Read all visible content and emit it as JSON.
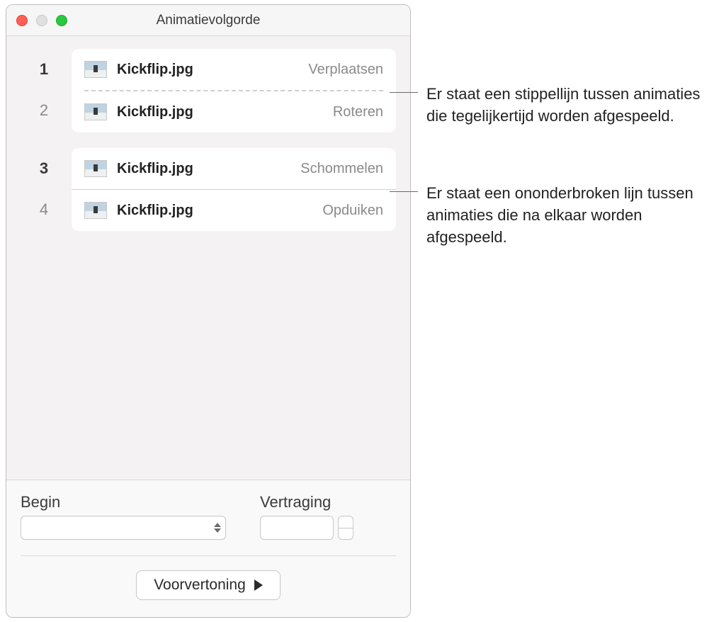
{
  "window": {
    "title": "Animatievolgorde"
  },
  "rows": [
    {
      "num": "1",
      "numClass": "",
      "file": "Kickflip.jpg",
      "effect": "Verplaatsen"
    },
    {
      "num": "2",
      "numClass": "secondary",
      "file": "Kickflip.jpg",
      "effect": "Roteren"
    },
    {
      "num": "3",
      "numClass": "",
      "file": "Kickflip.jpg",
      "effect": "Schommelen"
    },
    {
      "num": "4",
      "numClass": "secondary",
      "file": "Kickflip.jpg",
      "effect": "Opduiken"
    }
  ],
  "footer": {
    "begin_label": "Begin",
    "delay_label": "Vertraging",
    "preview_label": "Voorvertoning"
  },
  "callouts": {
    "dashed": "Er staat een stippellijn tussen animaties die tegelijkertijd worden afgespeeld.",
    "solid": "Er staat een ononderbroken lijn tussen animaties die na elkaar worden afgespeeld."
  }
}
